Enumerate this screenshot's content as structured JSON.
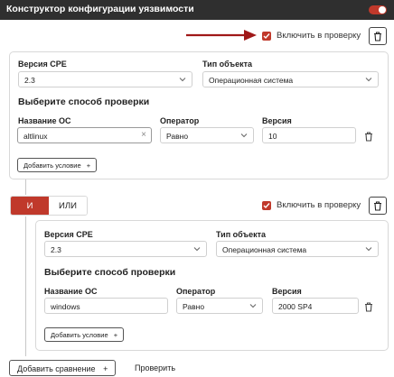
{
  "title": "Конструктор конфигурации уязвимости",
  "colors": {
    "accent": "#c0392b",
    "titlebar": "#2f2f2f"
  },
  "top": {
    "include_label": "Включить в проверку"
  },
  "block1": {
    "cpe_label": "Версия CPE",
    "cpe_value": "2.3",
    "type_label": "Тип объекта",
    "type_value": "Операционная система",
    "method_heading": "Выберите способ проверки",
    "os_label": "Название ОС",
    "os_value": "altlinux",
    "operator_label": "Оператор",
    "operator_value": "Равно",
    "version_label": "Версия",
    "version_value": "10",
    "add_condition": "Добавить условие"
  },
  "logic": {
    "and_label": "И",
    "or_label": "ИЛИ"
  },
  "block2": {
    "include_label": "Включить в проверку",
    "cpe_label": "Версия CPE",
    "cpe_value": "2.3",
    "type_label": "Тип объекта",
    "type_value": "Операционная система",
    "method_heading": "Выберите способ проверки",
    "os_label": "Название ОС",
    "os_value": "windows",
    "operator_label": "Оператор",
    "operator_value": "Равно",
    "version_label": "Версия",
    "version_value": "2000 SP4",
    "add_condition": "Добавить условие"
  },
  "footer": {
    "add_comparison": "Добавить сравнение",
    "check": "Проверить"
  },
  "icons": [
    "toggle-switch",
    "checkbox-checked-icon",
    "trash-icon",
    "chevron-down-icon",
    "clear-icon",
    "plus-icon",
    "arrow-annotation-icon"
  ]
}
